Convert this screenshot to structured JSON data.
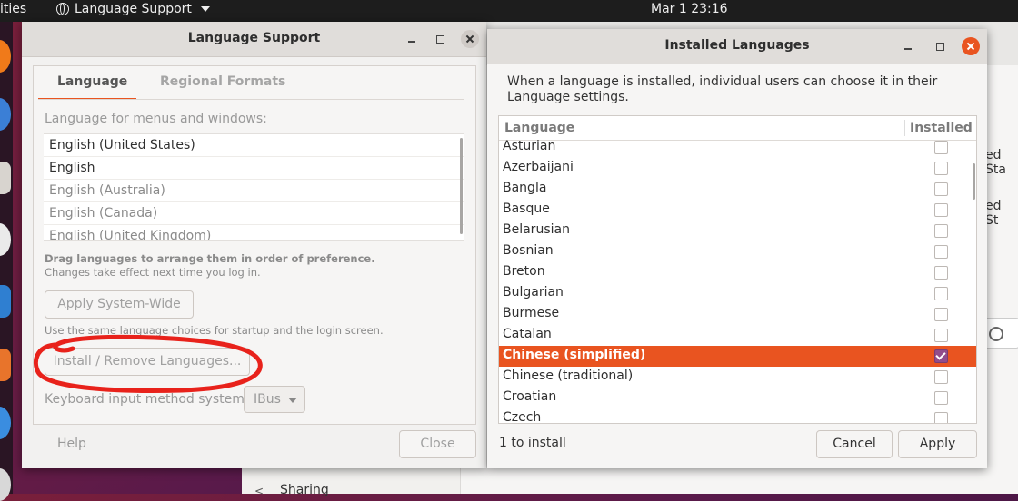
{
  "topbar": {
    "activities": "ities",
    "app_name": "Language Support",
    "clock": "Mar 1  23:16"
  },
  "background": {
    "fragment1": "ed Sta",
    "fragment2": "ed St",
    "sidebar_item": "Sharing"
  },
  "language_support": {
    "title": "Language Support",
    "tabs": [
      "Language",
      "Regional Formats"
    ],
    "section_label": "Language for menus and windows:",
    "languages": [
      "English (United States)",
      "English",
      "English (Australia)",
      "English (Canada)",
      "English (United Kingdom)"
    ],
    "drag_hint_bold": "Drag languages to arrange them in order of preference.",
    "drag_hint": "Changes take effect next time you log in.",
    "apply_button": "Apply System-Wide",
    "apply_hint": "Use the same language choices for startup and the login screen.",
    "install_button": "Install / Remove Languages...",
    "keyboard_label": "Keyboard input method system:",
    "keyboard_value": "IBus",
    "help_button": "Help",
    "close_button": "Close"
  },
  "installed_languages": {
    "title": "Installed Languages",
    "intro": "When a language is installed, individual users can choose it in their Language settings.",
    "col_language": "Language",
    "col_installed": "Installed",
    "rows": [
      {
        "name": "Asturian",
        "checked": false
      },
      {
        "name": "Azerbaijani",
        "checked": false
      },
      {
        "name": "Bangla",
        "checked": false
      },
      {
        "name": "Basque",
        "checked": false
      },
      {
        "name": "Belarusian",
        "checked": false
      },
      {
        "name": "Bosnian",
        "checked": false
      },
      {
        "name": "Breton",
        "checked": false
      },
      {
        "name": "Bulgarian",
        "checked": false
      },
      {
        "name": "Burmese",
        "checked": false
      },
      {
        "name": "Catalan",
        "checked": false
      },
      {
        "name": "Chinese (simplified)",
        "checked": true
      },
      {
        "name": "Chinese (traditional)",
        "checked": false
      },
      {
        "name": "Croatian",
        "checked": false
      },
      {
        "name": "Czech",
        "checked": false
      }
    ],
    "status": "1 to install",
    "cancel_button": "Cancel",
    "apply_button": "Apply"
  },
  "colors": {
    "accent": "#e95420",
    "annotation": "#e8221b",
    "checked": "#924d8b"
  }
}
